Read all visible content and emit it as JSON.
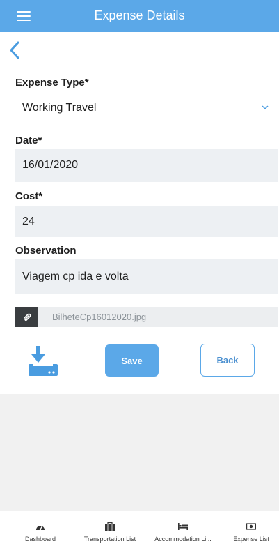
{
  "header": {
    "title": "Expense Details",
    "background_color": "#5ba8e8",
    "menu_icon": "hamburger-menu-icon",
    "back_icon": "chevron-left-icon"
  },
  "form": {
    "expense_type": {
      "label": "Expense Type*",
      "value": "Working Travel",
      "icon": "chevron-down-icon"
    },
    "date": {
      "label": "Date*",
      "value": "16/01/2020"
    },
    "cost": {
      "label": "Cost*",
      "value": "24"
    },
    "observation": {
      "label": "Observation",
      "value": "Viagem cp ida e volta"
    },
    "attachment": {
      "filename": "BilheteCp16012020.jpg",
      "icon": "paperclip-icon"
    }
  },
  "actions": {
    "download_icon": "download-icon",
    "save_label": "Save",
    "back_label": "Back"
  },
  "bottom_nav": {
    "items": [
      {
        "label": "Dashboard",
        "icon": "speedometer-icon"
      },
      {
        "label": "Transportation List",
        "icon": "briefcase-icon"
      },
      {
        "label": "Accommodation Li...",
        "icon": "bed-icon"
      },
      {
        "label": "Expense List",
        "icon": "money-bill-icon"
      }
    ]
  },
  "colors": {
    "accent": "#5ba8e8",
    "field_background": "#edf0f3",
    "attachment_icon_background": "#3a3d40"
  }
}
